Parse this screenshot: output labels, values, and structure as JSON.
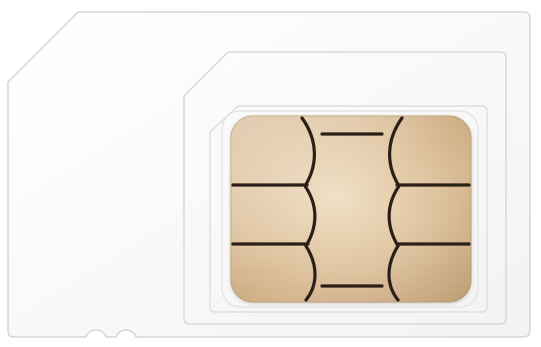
{
  "image": {
    "subject": "sim-card",
    "colors": {
      "background": "#ffffff",
      "card_body": "#fbfbfb",
      "card_edge": "#d9d9d9",
      "inner_cutout_edge": "#dcdcdc",
      "chip_gold_light": "#ead7b8",
      "chip_gold_mid": "#dcc09a",
      "chip_gold_dark": "#c9a97f",
      "chip_line": "#2b2118"
    }
  }
}
